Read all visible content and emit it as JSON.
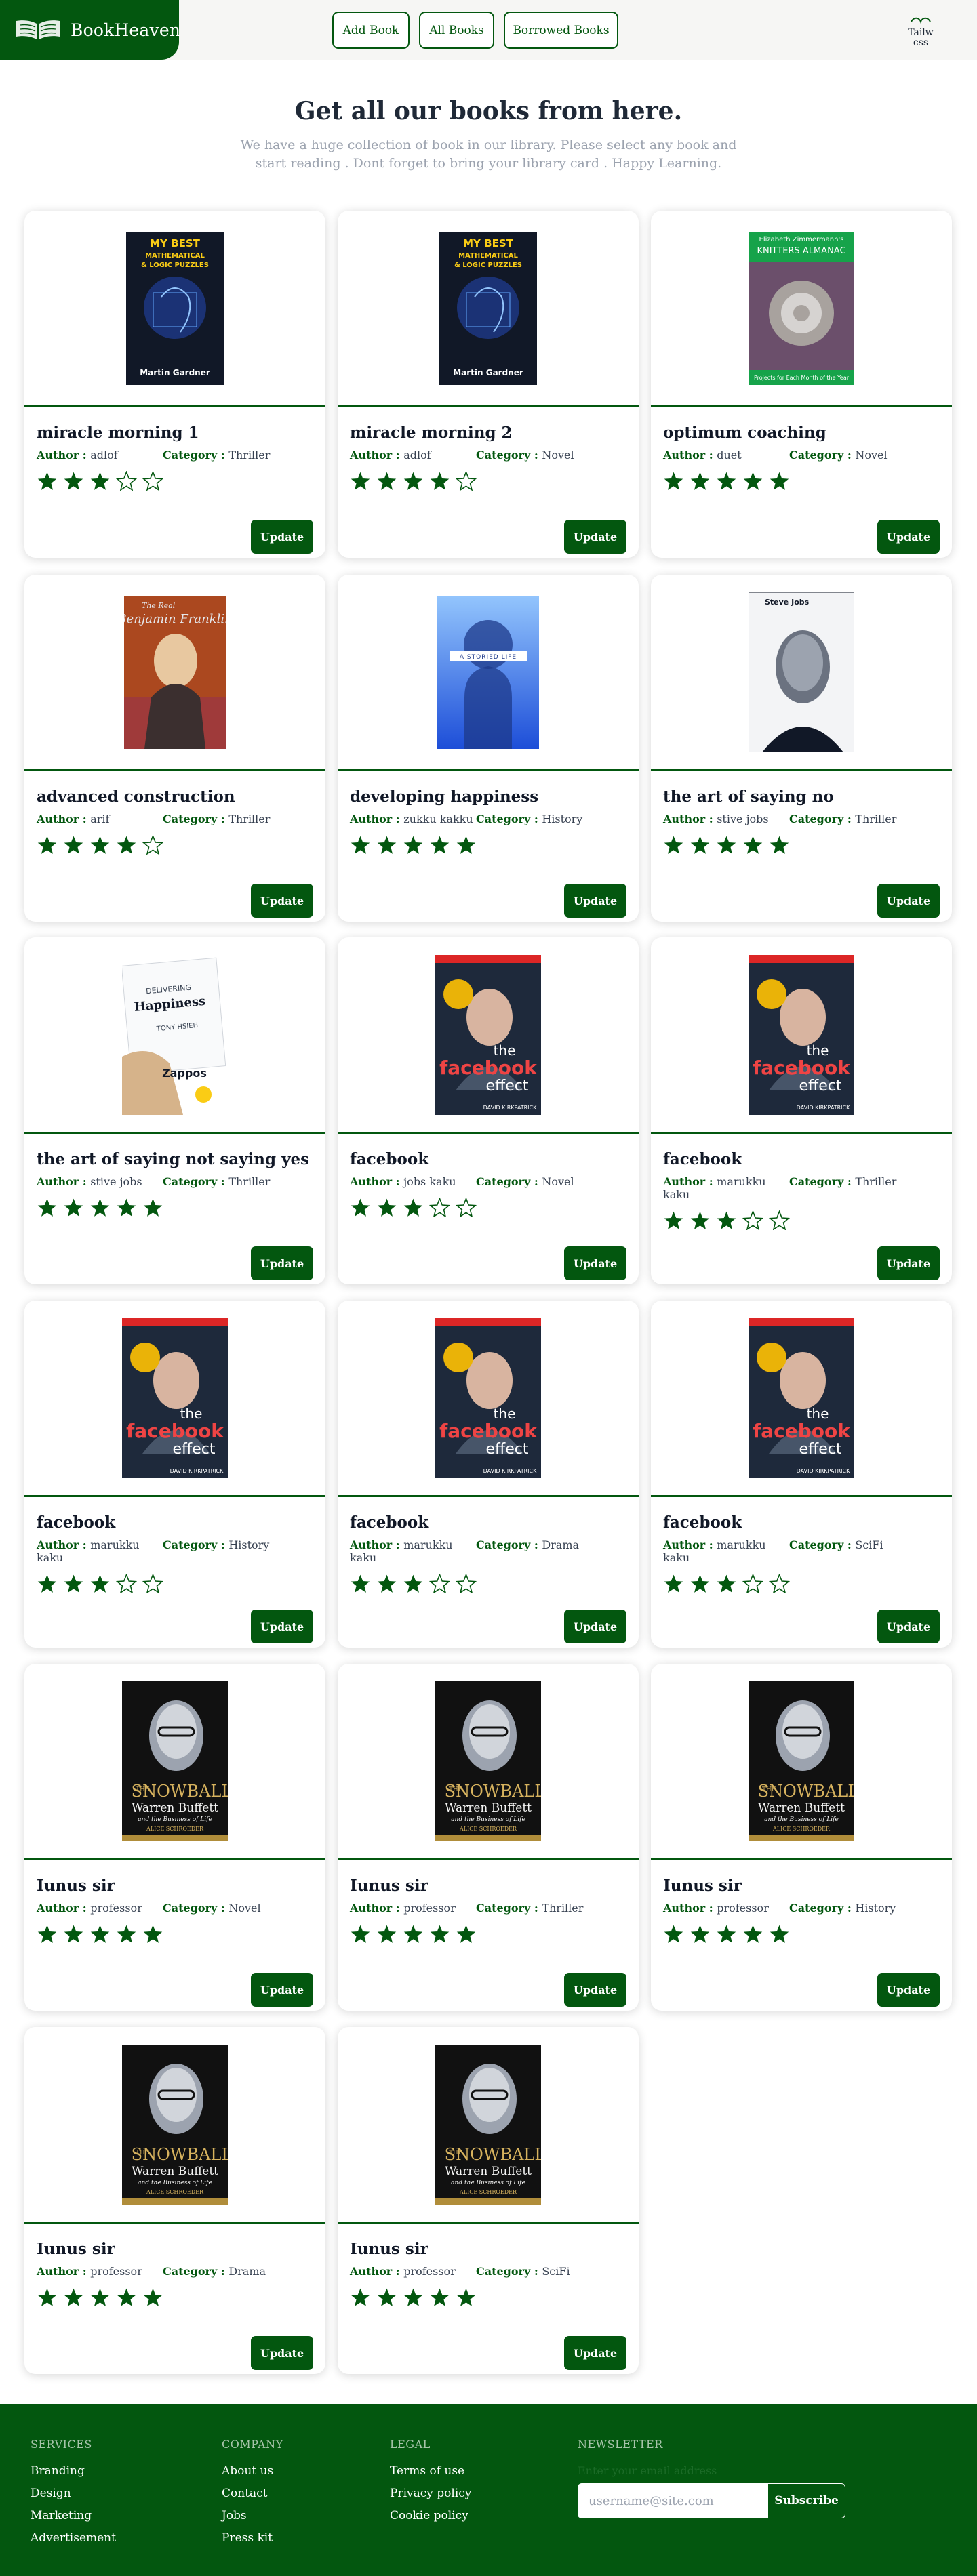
{
  "navbar": {
    "brand": "BookHeaven",
    "links": [
      "Add Book",
      "All Books",
      "Borrowed Books"
    ],
    "avatar_text": "Tailw\ncss"
  },
  "hero": {
    "title": "Get all our books from here.",
    "subtitle": "We have a huge collection of book in our library. Please select any book and start reading . Dont forget to bring your library card . Happy Learning."
  },
  "labels": {
    "author": "Author",
    "category": "Category",
    "update": "Update"
  },
  "books": [
    {
      "title": "miracle morning 1",
      "author": "adlof",
      "category": "Thriller",
      "rating": 3,
      "cover": "puzzles"
    },
    {
      "title": "miracle morning 2",
      "author": "adlof",
      "category": "Novel",
      "rating": 4,
      "cover": "puzzles"
    },
    {
      "title": "optimum coaching",
      "author": "duet",
      "category": "Novel",
      "rating": 5,
      "cover": "knitters"
    },
    {
      "title": "advanced construction",
      "author": "arif",
      "category": "Thriller",
      "rating": 4,
      "cover": "franklin"
    },
    {
      "title": "developing happiness",
      "author": "zukku kakku",
      "category": "History",
      "rating": 5,
      "cover": "blue"
    },
    {
      "title": "the art of saying no",
      "author": "stive jobs",
      "category": "Thriller",
      "rating": 5,
      "cover": "jobs"
    },
    {
      "title": "the art of saying not saying yes",
      "author": "stive jobs",
      "category": "Thriller",
      "rating": 5,
      "cover": "happiness"
    },
    {
      "title": "facebook",
      "author": "jobs kaku",
      "category": "Novel",
      "rating": 3,
      "cover": "facebook"
    },
    {
      "title": "facebook",
      "author": "marukku kaku",
      "category": "Thriller",
      "rating": 3,
      "cover": "facebook"
    },
    {
      "title": "facebook",
      "author": "marukku kaku",
      "category": "History",
      "rating": 3,
      "cover": "facebook"
    },
    {
      "title": "facebook",
      "author": "marukku kaku",
      "category": "Drama",
      "rating": 3,
      "cover": "facebook"
    },
    {
      "title": "facebook",
      "author": "marukku kaku",
      "category": "SciFi",
      "rating": 3,
      "cover": "facebook"
    },
    {
      "title": "Iunus sir",
      "author": "professor",
      "category": "Novel",
      "rating": 5,
      "cover": "snowball"
    },
    {
      "title": "Iunus sir",
      "author": "professor",
      "category": "Thriller",
      "rating": 5,
      "cover": "snowball"
    },
    {
      "title": "Iunus sir",
      "author": "professor",
      "category": "History",
      "rating": 5,
      "cover": "snowball"
    },
    {
      "title": "Iunus sir",
      "author": "professor",
      "category": "Drama",
      "rating": 5,
      "cover": "snowball"
    },
    {
      "title": "Iunus sir",
      "author": "professor",
      "category": "SciFi",
      "rating": 5,
      "cover": "snowball"
    }
  ],
  "covers": {
    "puzzles": {
      "lines": [
        "MY BEST",
        "MATHEMATICAL",
        "& LOGIC PUZZLES",
        "Martin Gardner"
      ]
    },
    "knitters": {
      "lines": [
        "Elizabeth Zimmermann's",
        "KNITTERS ALMANAC",
        "Projects for Each Month of the Year"
      ]
    },
    "franklin": {
      "lines": [
        "The Real",
        "Benjamin Franklin"
      ]
    },
    "blue": {
      "lines": [
        "A STORIED LIFE"
      ]
    },
    "jobs": {
      "lines": [
        "Steve Jobs"
      ]
    },
    "happiness": {
      "lines": [
        "DELIVERING",
        "Happiness",
        "TONY HSIEH",
        "Zappos"
      ]
    },
    "facebook": {
      "lines": [
        "the",
        "facebook",
        "effect",
        "DAVID KIRKPATRICK"
      ]
    },
    "snowball": {
      "lines": [
        "THE",
        "SNOWBALL",
        "Warren Buffett",
        "and the Business of Life",
        "ALICE SCHROEDER"
      ]
    }
  },
  "footer": {
    "services": {
      "heading": "SERVICES",
      "items": [
        "Branding",
        "Design",
        "Marketing",
        "Advertisement"
      ]
    },
    "company": {
      "heading": "COMPANY",
      "items": [
        "About us",
        "Contact",
        "Jobs",
        "Press kit"
      ]
    },
    "legal": {
      "heading": "LEGAL",
      "items": [
        "Terms of use",
        "Privacy policy",
        "Cookie policy"
      ]
    },
    "newsletter": {
      "heading": "NEWSLETTER",
      "label": "Enter your email address",
      "placeholder": "username@site.com",
      "button": "Subscribe"
    }
  },
  "colors": {
    "brand": "#03570f",
    "star": "#03570f"
  }
}
